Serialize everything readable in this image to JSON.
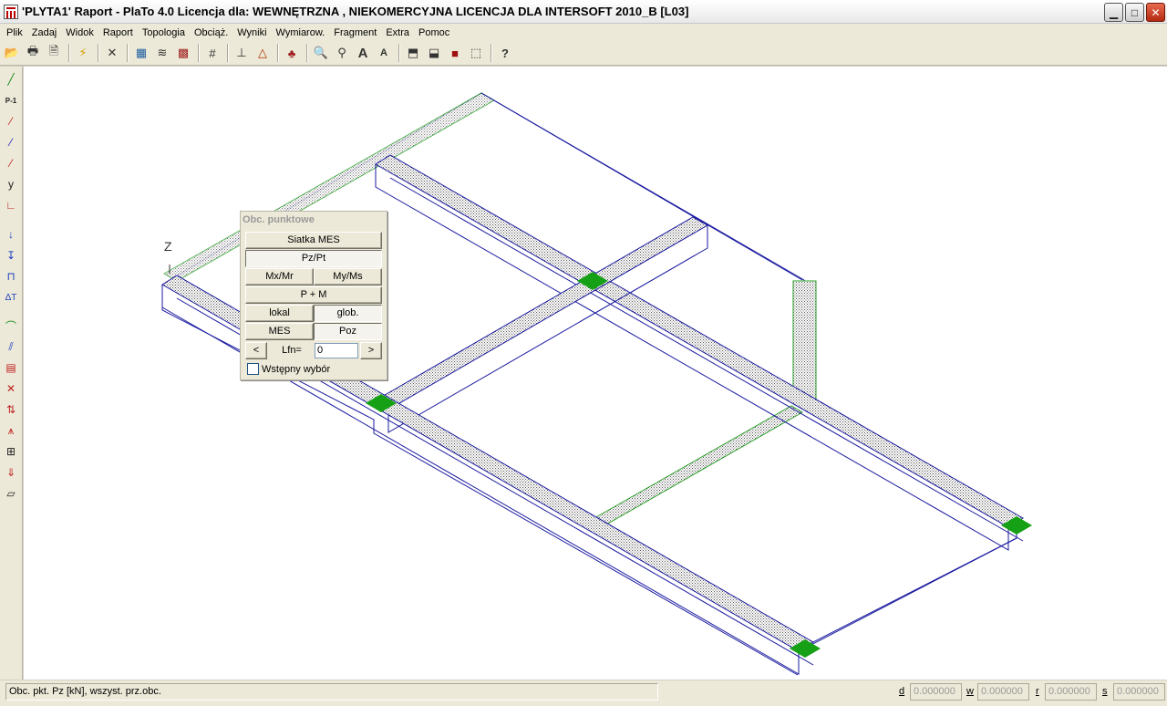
{
  "window": {
    "title": "'PLYTA1' Raport  - PlaTo 4.0  Licencja dla: WEWNĘTRZNA , NIEKOMERCYJNA LICENCJA DLA INTERSOFT 2010_B [L03]",
    "minimize": "▁",
    "maximize": "□",
    "close": "✕"
  },
  "menu": [
    "Plik",
    "Zadaj",
    "Widok",
    "Raport",
    "Topologia",
    "Obciąż.",
    "Wyniki",
    "Wymiarow.",
    "Fragment",
    "Extra",
    "Pomoc"
  ],
  "toolbar": {
    "icons": [
      "open-icon",
      "print-icon",
      "print-preview-icon",
      "lightning-icon",
      "delete-icon",
      "calculator-icon",
      "layers-icon",
      "database-icon",
      "grid-icon",
      "measure-icon",
      "triangle-icon",
      "color-icon",
      "zoom-icon",
      "find-icon",
      "font-larger-icon",
      "font-smaller-icon",
      "view-3d-icon",
      "view-box-icon",
      "view-solid-icon",
      "view-wire-icon",
      "help-icon"
    ],
    "glyphs": [
      "📂",
      "🖶",
      "🗎",
      "⚡",
      "✕",
      "▦",
      "≋",
      "▩",
      "#",
      "⊥",
      "△",
      "♣",
      "🔍",
      "⚲",
      "A",
      "A",
      "⬒",
      "⬓",
      "■",
      "⬚",
      "?"
    ]
  },
  "left_toolbar": {
    "glyphs": [
      "╱",
      "P-1",
      "⁄",
      "⁄",
      "⁄",
      "y",
      "∟",
      "↓",
      "↧",
      "⊓",
      "ΔT",
      "⌒",
      "⫽",
      "▤",
      "✕",
      "⇅",
      "⩚",
      "⊞",
      "⇓",
      "▱"
    ]
  },
  "canvas": {
    "axis_label": "Z"
  },
  "panel": {
    "title": "Obc. punktowe",
    "siatka_mes": "Siatka MES",
    "pz_pt": "Pz/Pt",
    "mx_mr": "Mx/Mr",
    "my_ms": "My/Ms",
    "p_plus_m": "P + M",
    "lokal": "lokal",
    "glob": "glob.",
    "mes": "MES",
    "poz": "Poz",
    "prev": "<",
    "next": ">",
    "lfn_label": "Lfn=",
    "lfn_value": "0",
    "wstepny_wybor": "Wstępny wybór"
  },
  "status": {
    "text": "Obc. pkt.   Pz [kN], wszyst. prz.obc.",
    "d_label": "d",
    "d_value": "0.000000",
    "w_label": "w",
    "w_value": "0.000000",
    "r_label": "r",
    "r_value": "0.000000",
    "s_label": "s",
    "s_value": "0.000000"
  }
}
